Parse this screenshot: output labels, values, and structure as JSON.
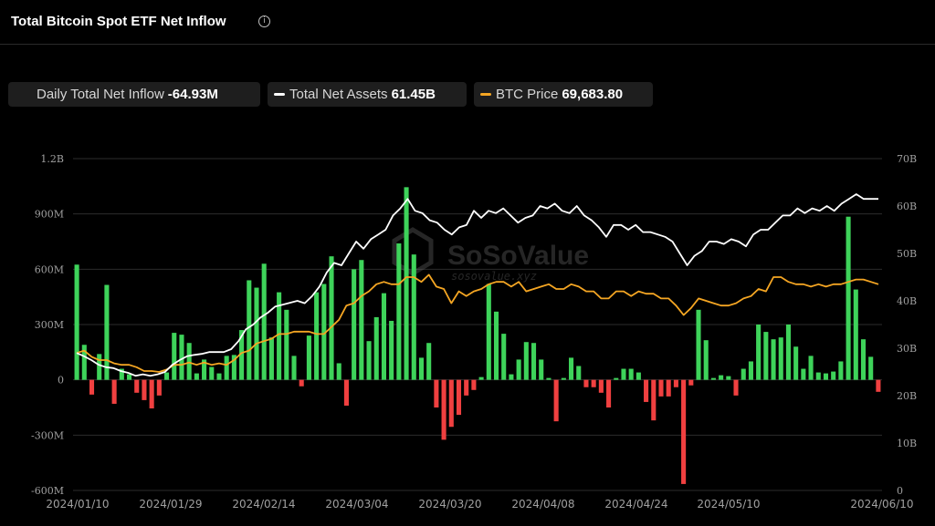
{
  "header": {
    "title": "Total Bitcoin Spot ETF Net Inflow",
    "info_icon": "info-icon"
  },
  "legend": {
    "inflow": {
      "label": "Daily Total Net Inflow",
      "value": "-64.93M"
    },
    "assets": {
      "label": "Total Net Assets",
      "value": "61.45B"
    },
    "price": {
      "label": "BTC Price",
      "value": "69,683.80"
    }
  },
  "colors": {
    "positive": "#3ed35a",
    "negative": "#f04040",
    "assets_line": "#ffffff",
    "price_line": "#f5a623",
    "grid": "#2c2c2c",
    "axis_text": "#a0a0a0"
  },
  "watermark": {
    "brand": "SoSoValue",
    "url": "sosovalue.xyz"
  },
  "chart_data": {
    "type": "bar",
    "left_axis": {
      "ticks": [
        "1.2B",
        "900M",
        "600M",
        "300M",
        "0",
        "-300M",
        "-600M"
      ],
      "ylim": [
        -600,
        1200
      ],
      "unit": "M"
    },
    "right_axis": {
      "ticks": [
        "70B",
        "60B",
        "50B",
        "40B",
        "30B",
        "20B",
        "10B",
        "0"
      ],
      "ylim": [
        0,
        70
      ],
      "unit": "B"
    },
    "x_tick_labels": [
      "2024/01/10",
      "2024/01/29",
      "2024/02/14",
      "2024/03/04",
      "2024/03/20",
      "2024/04/08",
      "2024/04/24",
      "2024/05/10",
      "2024/06/10"
    ],
    "series": [
      {
        "name": "Daily Total Net Inflow",
        "axis": "left",
        "values": [
          625,
          190,
          -80,
          140,
          515,
          -130,
          60,
          30,
          -70,
          -110,
          -155,
          -85,
          40,
          255,
          245,
          200,
          35,
          110,
          70,
          35,
          130,
          135,
          270,
          540,
          500,
          630,
          230,
          475,
          380,
          130,
          -35,
          240,
          475,
          520,
          670,
          90,
          -140,
          600,
          650,
          210,
          340,
          470,
          320,
          740,
          1045,
          680,
          120,
          200,
          -150,
          -325,
          -255,
          -190,
          -85,
          -55,
          15,
          520,
          370,
          250,
          30,
          110,
          205,
          200,
          110,
          10,
          -225,
          10,
          120,
          75,
          -40,
          -40,
          -70,
          -150,
          10,
          60,
          60,
          40,
          -120,
          -220,
          -90,
          -90,
          -40,
          -565,
          -30,
          380,
          215,
          10,
          25,
          20,
          -85,
          60,
          100,
          300,
          260,
          220,
          230,
          300,
          180,
          60,
          130,
          40,
          35,
          45,
          100,
          885,
          490,
          220,
          125,
          -65
        ]
      },
      {
        "name": "Total Net Assets",
        "axis": "right",
        "values": [
          29,
          28.3,
          27.5,
          26.5,
          26,
          25.8,
          25.2,
          24.8,
          24.2,
          24.5,
          24.2,
          24.5,
          25,
          26.5,
          27.5,
          28.3,
          28.6,
          28.8,
          29.2,
          29.2,
          29.2,
          29.8,
          31.5,
          34,
          35,
          36.5,
          37.5,
          38.8,
          39.2,
          39.6,
          40,
          39.5,
          41,
          43,
          46,
          48,
          47.5,
          50,
          52.5,
          51,
          53,
          54,
          55,
          58,
          59.5,
          61.5,
          59,
          58.5,
          57,
          56.5,
          55,
          54,
          55.5,
          56,
          59,
          57.5,
          59,
          58.5,
          59.5,
          58,
          56.5,
          57.5,
          58,
          60,
          59.5,
          60.5,
          59,
          58.5,
          60,
          58,
          57,
          55.5,
          53.5,
          56,
          56,
          55,
          56,
          54.5,
          54.5,
          54,
          53.5,
          52.5,
          50,
          47.5,
          49.5,
          50.5,
          52.5,
          52.5,
          52,
          53,
          52.5,
          51.5,
          54,
          55,
          55,
          56.5,
          58,
          58,
          59.5,
          58.5,
          59.5,
          59,
          60,
          59,
          60.5,
          61.5,
          62.5,
          61.5,
          61.5,
          61.5
        ]
      },
      {
        "name": "BTC Price",
        "axis": "right",
        "values": [
          29,
          29.5,
          28.2,
          27.5,
          27.5,
          26.8,
          26.5,
          26.5,
          26,
          25.2,
          25.2,
          25,
          25.5,
          26.5,
          26.5,
          27,
          26.5,
          27,
          26.5,
          26.8,
          26.5,
          27.5,
          29,
          29.5,
          31,
          31.5,
          32,
          33,
          33,
          33.5,
          33.5,
          33.5,
          33,
          33,
          34.5,
          36,
          39,
          39.5,
          41,
          42,
          43.5,
          44,
          43.5,
          43.5,
          45,
          45,
          44,
          45.5,
          43,
          42.5,
          39.5,
          42,
          41,
          42,
          42.5,
          43.5,
          44,
          44,
          43,
          44,
          42,
          42.5,
          43,
          43.5,
          42.5,
          42.5,
          43.5,
          43,
          42,
          42,
          40.5,
          40.5,
          42,
          42,
          41,
          42,
          41.5,
          41.5,
          40.5,
          40.5,
          39,
          37,
          38.5,
          40.5,
          40,
          39.5,
          39,
          39,
          39.5,
          40.5,
          41,
          42.5,
          42,
          45,
          45,
          44,
          43.5,
          43.5,
          43,
          43.5,
          43,
          43.5,
          43.5,
          44,
          44.5,
          44.5,
          44,
          43.5
        ]
      }
    ]
  }
}
